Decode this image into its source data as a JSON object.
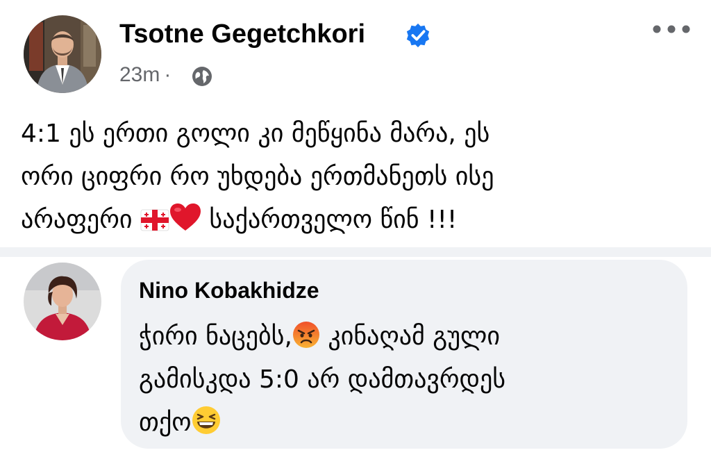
{
  "post": {
    "author": {
      "name": "Tsotne Gegetchkori",
      "verified": true,
      "avatar_icon": "person-in-suit-avatar"
    },
    "timestamp": "23m",
    "separator": "·",
    "audience_icon": "globe-icon",
    "more_icon": "more-options-icon",
    "text_lines": {
      "line1": "4:1 ეს ერთი გოლი კი მეწყინა მარა, ეს",
      "line2": "ორი ციფრი რო უხდება ერთმანეთს ისე",
      "line3_prefix": "არაფერი",
      "line3_suffix": "საქართველო წინ !!!"
    },
    "emojis": [
      "georgia-flag-emoji",
      "red-heart-emoji"
    ]
  },
  "comment": {
    "author": {
      "name": "Nino Kobakhidze",
      "avatar_icon": "woman-in-red-avatar"
    },
    "text_lines": {
      "line1_prefix": "ჭირი ნაცებს,",
      "line1_suffix": " კინაღამ გული",
      "line2": "გამისკდა 5:0 არ დამთავრდეს",
      "line3": "თქო"
    },
    "emojis": [
      "angry-face-emoji",
      "grinning-squinting-face-emoji"
    ]
  },
  "colors": {
    "text_primary": "#050505",
    "text_secondary": "#65676b",
    "verified_blue": "#1877f2",
    "bubble_bg": "#f0f2f5",
    "heart_red": "#e0162b"
  }
}
